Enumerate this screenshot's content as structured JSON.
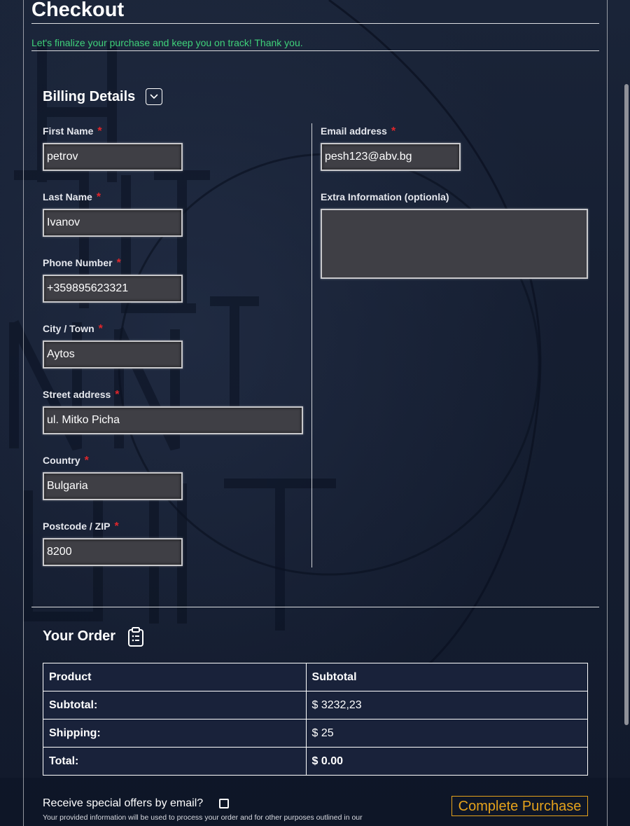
{
  "header": {
    "title": "Checkout",
    "subtitle": "Let's finalize your purchase and keep you on track! Thank you."
  },
  "billing": {
    "heading": "Billing Details",
    "toggle_icon": "chevron-down-icon",
    "required_mark": "*",
    "fields": {
      "first_name": {
        "label": "First Name",
        "value": "petrov"
      },
      "last_name": {
        "label": "Last Name",
        "value": "Ivanov"
      },
      "phone": {
        "label": "Phone Number",
        "value": "+359895623321"
      },
      "city": {
        "label": "City / Town",
        "value": "Aytos"
      },
      "street": {
        "label": "Street address",
        "value": "ul. Mitko Picha"
      },
      "country": {
        "label": "Country",
        "value": "Bulgaria"
      },
      "postcode": {
        "label": "Postcode / ZIP",
        "value": "8200"
      },
      "email": {
        "label": "Email address",
        "value": "pesh123@abv.bg"
      },
      "extra": {
        "label": "Extra Information (optionla)",
        "value": ""
      }
    }
  },
  "order": {
    "heading": "Your Order",
    "heading_icon": "clipboard-list-icon",
    "columns": [
      "Product",
      "Subtotal"
    ],
    "rows": [
      {
        "label": "Subtotal:",
        "value": "$ 3232,23"
      },
      {
        "label": "Shipping:",
        "value": "$ 25"
      },
      {
        "label": "Total:",
        "value": "$ 0.00"
      }
    ]
  },
  "footer": {
    "offers_label": "Receive special offers by email?",
    "offers_checked": false,
    "privacy_text": "Your provided information will be used to process your order and for other purposes outlined in our",
    "purchase_button": "Complete Purchase"
  },
  "colors": {
    "accent_green": "#3fd27a",
    "required_red": "#e0262b",
    "button_gold": "#e5a21b",
    "input_bg": "#3f3f45",
    "page_bg": "#151e31"
  }
}
